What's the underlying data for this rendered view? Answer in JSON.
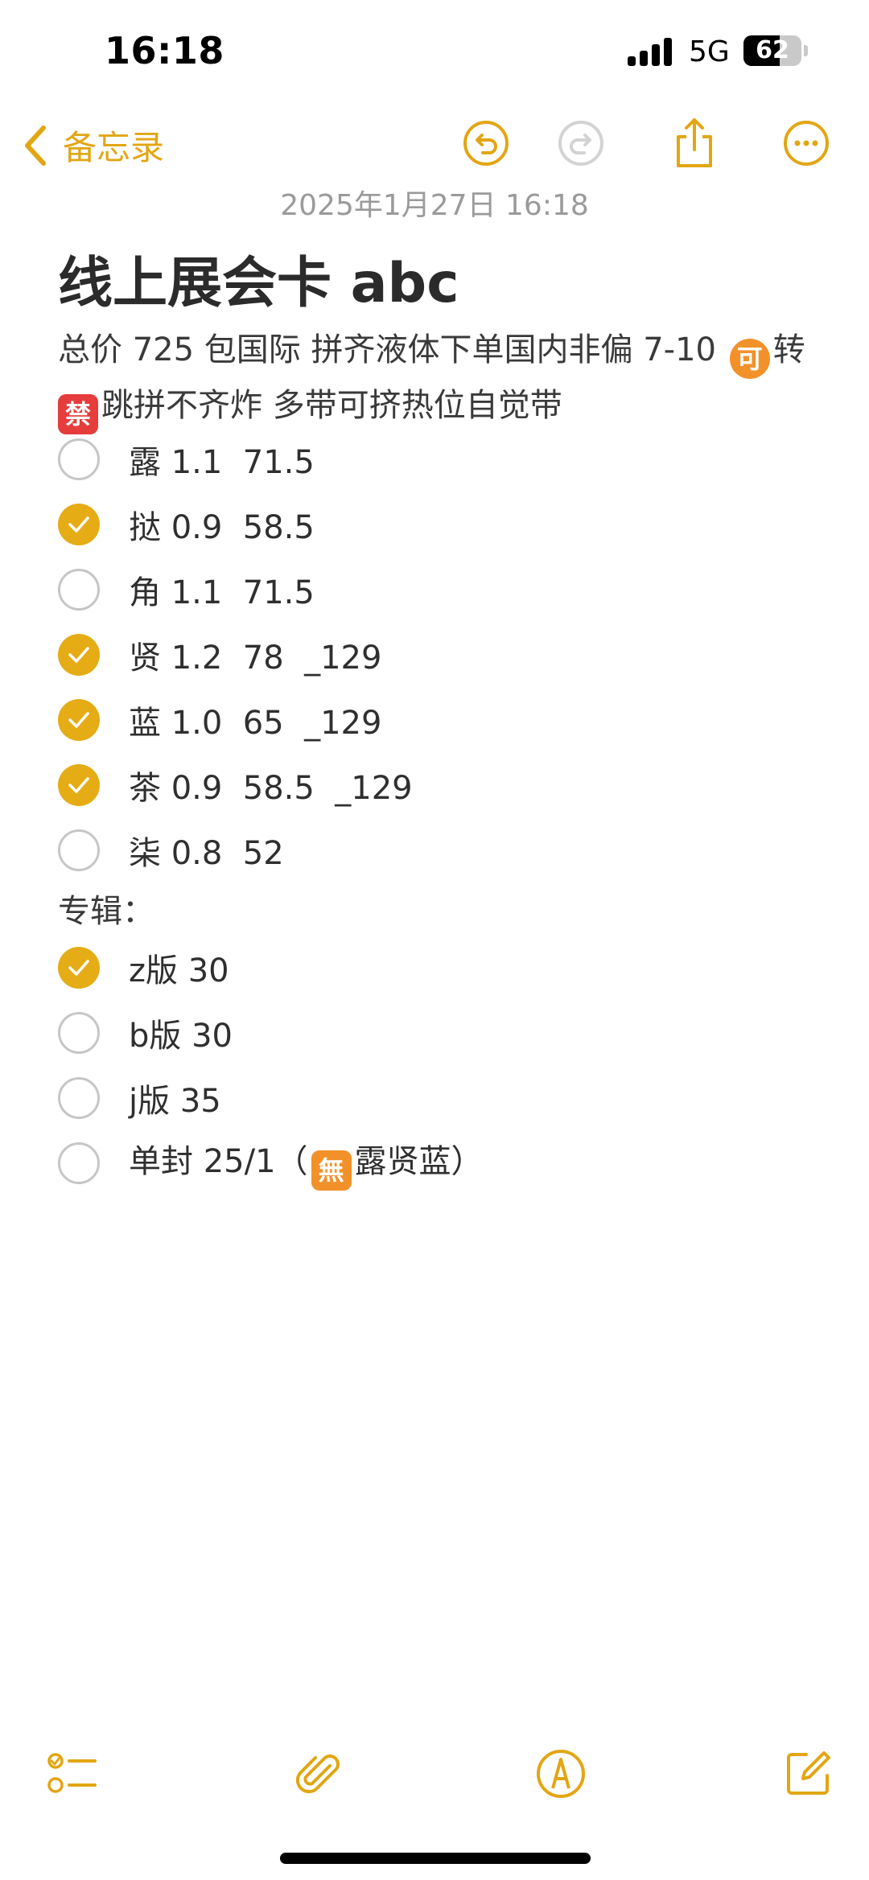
{
  "status_bar": {
    "time": "16:18",
    "network": "5G",
    "battery": "62",
    "battery_level": 0.62
  },
  "nav": {
    "back_label": "备忘录"
  },
  "note": {
    "date": "2025年1月27日 16:18",
    "title": "线上展会卡 abc",
    "desc_line1_prefix": "总价 725 包国际 拼齐液体下单国内非偏 7-10 ",
    "emoji_1": "可",
    "desc_line1_suffix": "转",
    "emoji_2": "禁",
    "desc_line2": "跳拼不齐炸 多带可挤热位自觉带"
  },
  "checklist": [
    {
      "text": "露 1.1  71.5",
      "checked": false
    },
    {
      "text": "挞 0.9  58.5",
      "checked": true
    },
    {
      "text": "角 1.1  71.5",
      "checked": false
    },
    {
      "text": "贤 1.2  78  _129",
      "checked": true
    },
    {
      "text": "蓝 1.0  65  _129",
      "checked": true
    },
    {
      "text": "茶 0.9  58.5  _129",
      "checked": true
    },
    {
      "text": "柒 0.8  52",
      "checked": false
    }
  ],
  "album_section": {
    "heading": "专辑："
  },
  "album_list": [
    {
      "text": "z版 30",
      "checked": true
    },
    {
      "text": "b版 30",
      "checked": false
    },
    {
      "text": "j版 35",
      "checked": false
    },
    {
      "text_prefix": "单封 25/1（",
      "emoji": "無",
      "text_suffix": "露贤蓝）",
      "checked": false
    }
  ],
  "colors": {
    "accent": "#e5ac16",
    "accent_text": "#e2a613",
    "unchecked_border": "#c6c6c6"
  },
  "icons": {
    "back": "chevron-left-icon",
    "undo": "undo-icon",
    "redo": "redo-icon",
    "share": "share-icon",
    "more": "more-icon",
    "checklist": "checklist-icon",
    "attach": "paperclip-icon",
    "markup": "markup-pen-icon",
    "compose": "compose-icon"
  }
}
